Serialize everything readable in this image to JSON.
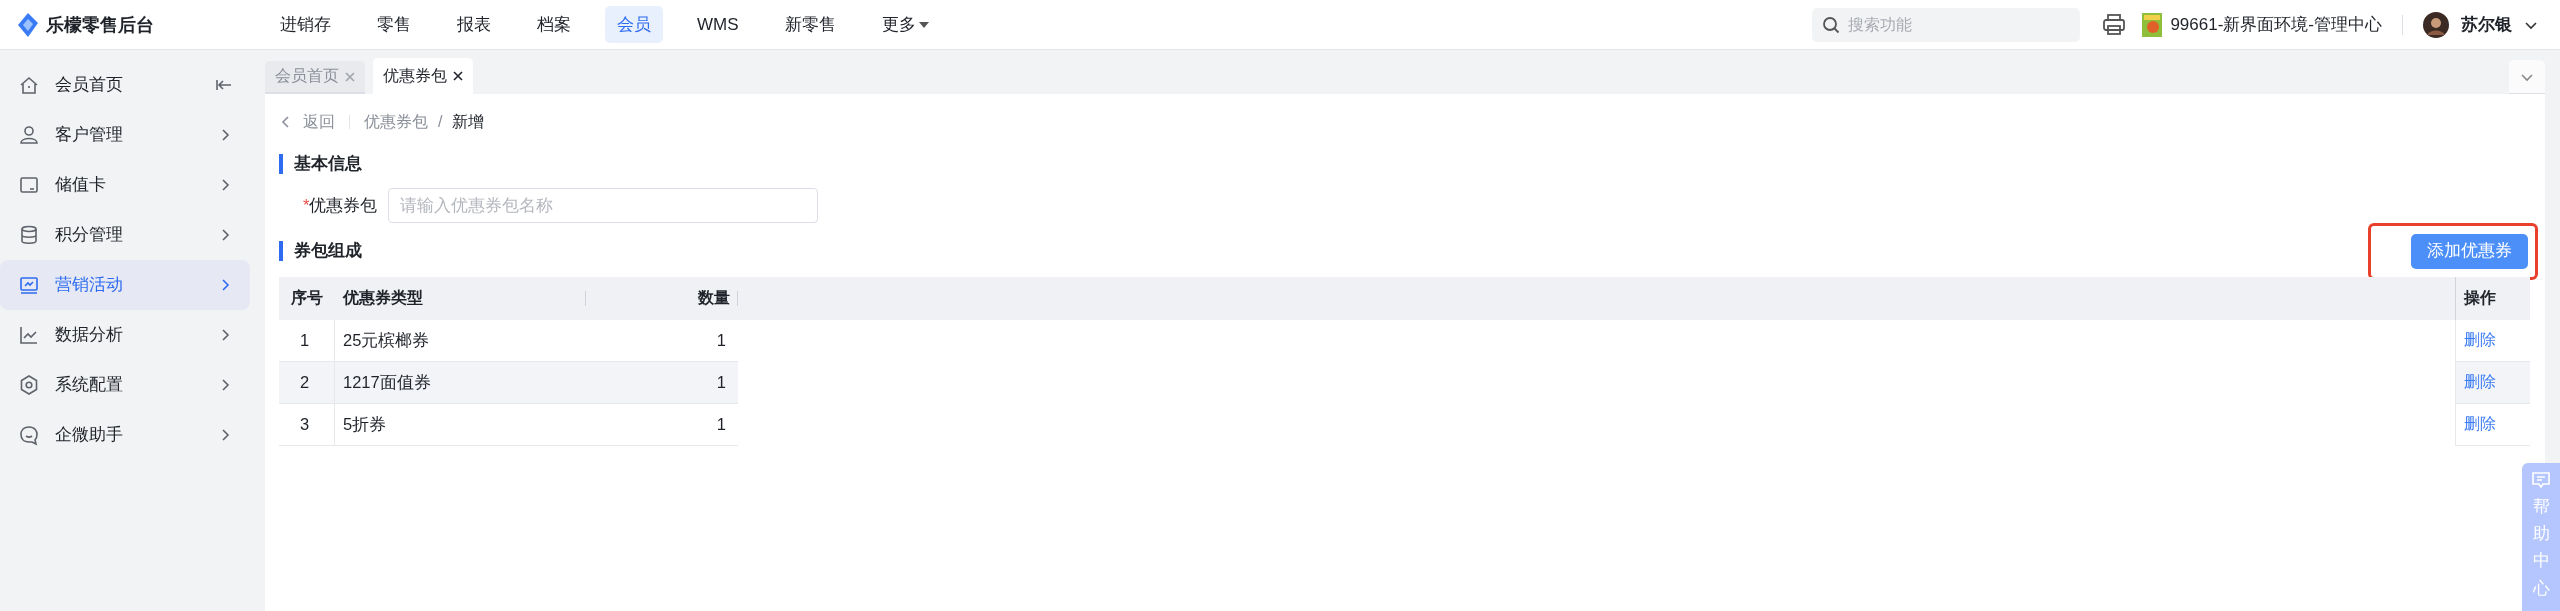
{
  "app": {
    "title": "乐檬零售后台"
  },
  "top_nav": [
    {
      "label": "进销存",
      "selected": false,
      "dropdown": false
    },
    {
      "label": "零售",
      "selected": false,
      "dropdown": false
    },
    {
      "label": "报表",
      "selected": false,
      "dropdown": false
    },
    {
      "label": "档案",
      "selected": false,
      "dropdown": false
    },
    {
      "label": "会员",
      "selected": true,
      "dropdown": false
    },
    {
      "label": "WMS",
      "selected": false,
      "dropdown": false
    },
    {
      "label": "新零售",
      "selected": false,
      "dropdown": false
    },
    {
      "label": "更多",
      "selected": false,
      "dropdown": true
    }
  ],
  "search": {
    "placeholder": "搜索功能"
  },
  "store": {
    "label": "99661-新界面环境-管理中心"
  },
  "user": {
    "name": "苏尔银"
  },
  "sidebar": {
    "items": [
      {
        "label": "会员首页",
        "kind": "collapse",
        "selected": false
      },
      {
        "label": "客户管理",
        "kind": "menu",
        "selected": false
      },
      {
        "label": "储值卡",
        "kind": "menu",
        "selected": false
      },
      {
        "label": "积分管理",
        "kind": "menu",
        "selected": false
      },
      {
        "label": "营销活动",
        "kind": "menu",
        "selected": true
      },
      {
        "label": "数据分析",
        "kind": "menu",
        "selected": false
      },
      {
        "label": "系统配置",
        "kind": "menu",
        "selected": false
      },
      {
        "label": "企微助手",
        "kind": "menu",
        "selected": false
      }
    ]
  },
  "tabs": [
    {
      "label": "会员首页",
      "selected": false
    },
    {
      "label": "优惠券包",
      "selected": true
    }
  ],
  "breadcrumb": {
    "back": "返回",
    "separator": "/",
    "items": [
      "优惠券包",
      "新增"
    ]
  },
  "basic_info": {
    "title": "基本信息",
    "field": {
      "label": "优惠券包",
      "required": true,
      "required_mark": "*",
      "placeholder": "请输入优惠券包名称"
    }
  },
  "composition": {
    "title": "券包组成",
    "add_button": {
      "label": "添加优惠券",
      "highlighted": true
    },
    "table": {
      "columns": [
        "序号",
        "优惠券类型",
        "数量",
        "操作"
      ],
      "rows": [
        {
          "index": "1",
          "type": "25元槟榔券",
          "quantity": "1",
          "action": "删除",
          "highlighted": false
        },
        {
          "index": "2",
          "type": "1217面值券",
          "quantity": "1",
          "action": "删除",
          "highlighted": true
        },
        {
          "index": "3",
          "type": "5折券",
          "quantity": "1",
          "action": "删除",
          "highlighted": false
        }
      ]
    }
  },
  "help": {
    "label": "帮助中心"
  }
}
